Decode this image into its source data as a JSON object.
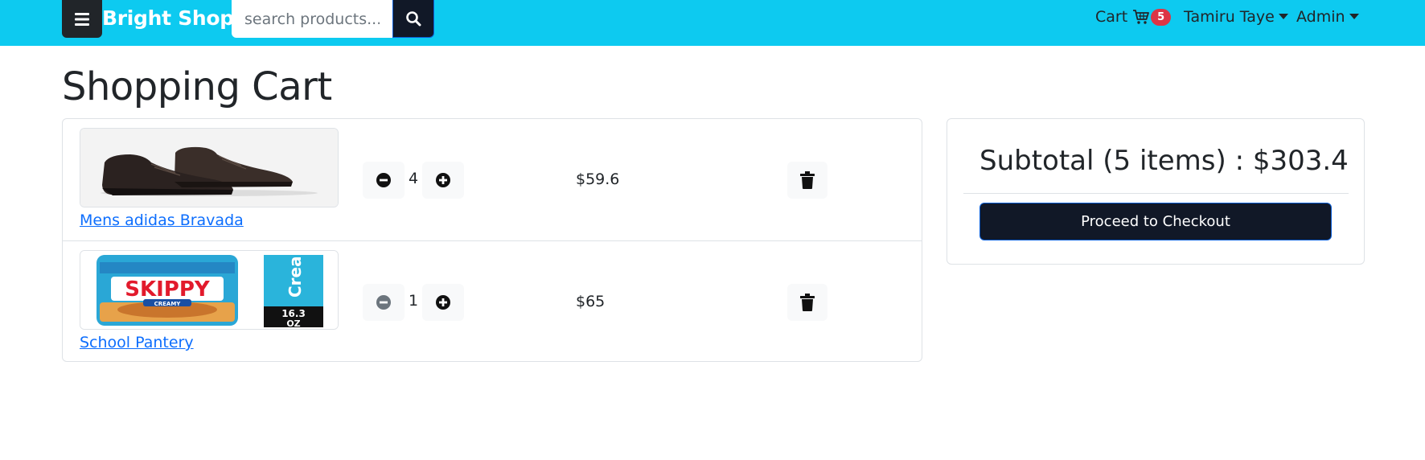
{
  "navbar": {
    "brand": "Bright Shop",
    "search_placeholder": "search products...",
    "cart_label": "Cart",
    "cart_count": "5",
    "user_name": "Tamiru Taye",
    "admin_label": "Admin",
    "bg_color": "#0dcaf0"
  },
  "page": {
    "title": "Shopping Cart"
  },
  "cart": {
    "items": [
      {
        "name": "Mens adidas Bravada",
        "quantity": "4",
        "price": "$59.6",
        "image": "brown-leather-shoes"
      },
      {
        "name": "School Pantery",
        "quantity": "1",
        "price": "$65",
        "image": "skippy-creamy-peanut-butter-jar"
      }
    ]
  },
  "summary": {
    "subtotal": "Subtotal (5 items) : $303.4",
    "checkout_label": "Proceed to Checkout"
  },
  "skippy_label": {
    "brand": "SKIPPY",
    "variant": "CREAMY",
    "side_text": "Creamy",
    "size": "16.3 OZ"
  },
  "colors": {
    "accent": "#0dcaf0",
    "dark": "#111827",
    "badge": "#dc3545",
    "link": "#0d6efd"
  }
}
